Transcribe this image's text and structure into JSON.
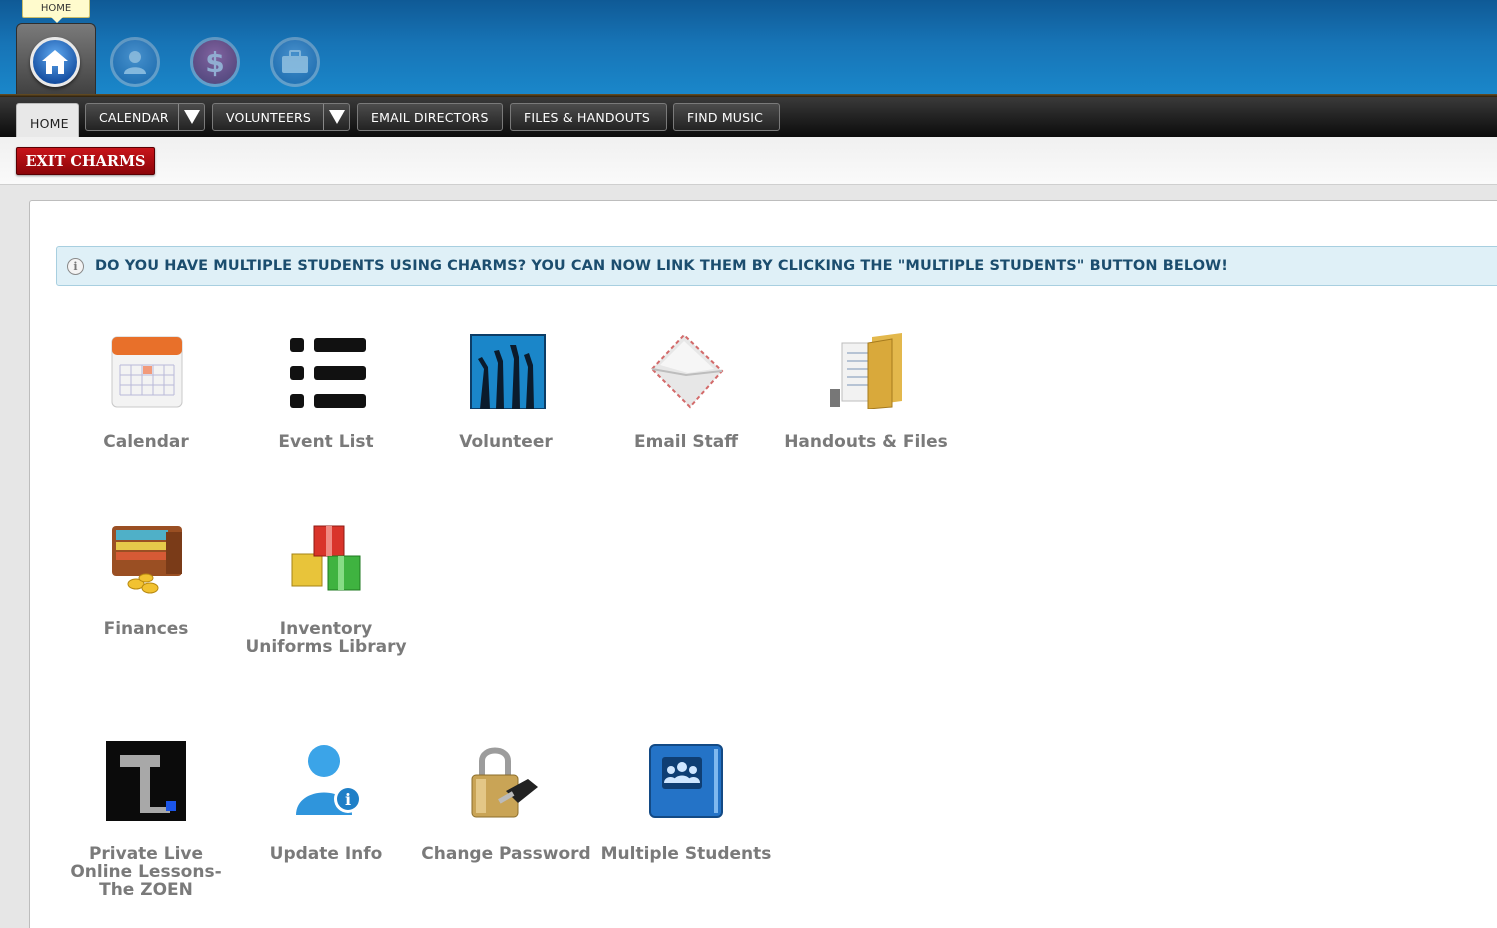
{
  "header": {
    "tooltip": "HOME",
    "icons": [
      "home-icon",
      "person-icon",
      "dollar-icon",
      "briefcase-icon"
    ],
    "accent": "#1774b6"
  },
  "nav": {
    "tabs": [
      {
        "label": "HOME",
        "active": true
      },
      {
        "label": "CALENDAR",
        "dropdown": true
      },
      {
        "label": "VOLUNTEERS",
        "dropdown": true
      },
      {
        "label": "EMAIL DIRECTORS"
      },
      {
        "label": "FILES & HANDOUTS"
      },
      {
        "label": "FIND MUSIC"
      }
    ]
  },
  "exit_button": {
    "label": "EXIT CHARMS",
    "color": "#b10d12"
  },
  "banner": {
    "text": "DO YOU HAVE MULTIPLE STUDENTS USING CHARMS? YOU CAN NOW LINK THEM BY CLICKING THE \"MULTIPLE STUDENTS\" BUTTON BELOW!"
  },
  "tiles": [
    {
      "label": "Calendar",
      "icon": "calendar-icon"
    },
    {
      "label": "Event List",
      "icon": "list-icon"
    },
    {
      "label": "Volunteer",
      "icon": "raised-hands-icon"
    },
    {
      "label": "Email Staff",
      "icon": "envelope-icon"
    },
    {
      "label": "Handouts & Files",
      "icon": "folder-icon"
    },
    {
      "label": "Finances",
      "icon": "wallet-icon"
    },
    {
      "label": "Inventory Uniforms Library",
      "icon": "boxes-icon"
    },
    {
      "label": "Private Live Online Lessons-The ZOEN",
      "icon": "zoen-logo-icon"
    },
    {
      "label": "Update Info",
      "icon": "user-info-icon"
    },
    {
      "label": "Change Password",
      "icon": "padlock-key-icon"
    },
    {
      "label": "Multiple Students",
      "icon": "group-book-icon"
    }
  ]
}
